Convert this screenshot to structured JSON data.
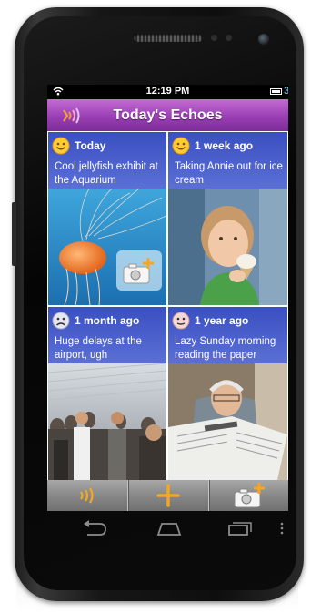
{
  "status_bar": {
    "time": "12:19 PM",
    "battery_label": "3",
    "wifi_icon": "wifi-icon",
    "battery_icon": "battery-icon"
  },
  "app_bar": {
    "title": "Today's Echoes",
    "logo_icon": "echo-sound-icon"
  },
  "cards": [
    {
      "when": "Today",
      "text": "Cool jellyfish exhibit at the Aquarium",
      "mood": "happy-face-icon",
      "photo": "jellyfish-photo",
      "overlay": "add-photo-icon"
    },
    {
      "when": "1 week ago",
      "text": "Taking Annie out for ice cream",
      "mood": "happy-face-icon",
      "photo": "girl-ice-cream-photo"
    },
    {
      "when": "1 month ago",
      "text": "Huge delays at the airport, ugh",
      "mood": "sad-face-icon",
      "photo": "airport-crowd-photo"
    },
    {
      "when": "1 year ago",
      "text": "Lazy Sunday morning reading the paper",
      "mood": "neutral-face-icon",
      "photo": "man-reading-paper-photo"
    }
  ],
  "bottom_toolbar": {
    "buttons": [
      "echo-sound-icon",
      "plus-icon",
      "add-photo-icon"
    ]
  },
  "nav_buttons": [
    "back-icon",
    "home-icon",
    "recent-apps-icon",
    "menu-dots-icon"
  ],
  "colors": {
    "app_bar": "#9a3fb4",
    "card_header": "#4c5ec9",
    "accent_orange": "#f5a623",
    "toolbar_gray": "#888888"
  }
}
